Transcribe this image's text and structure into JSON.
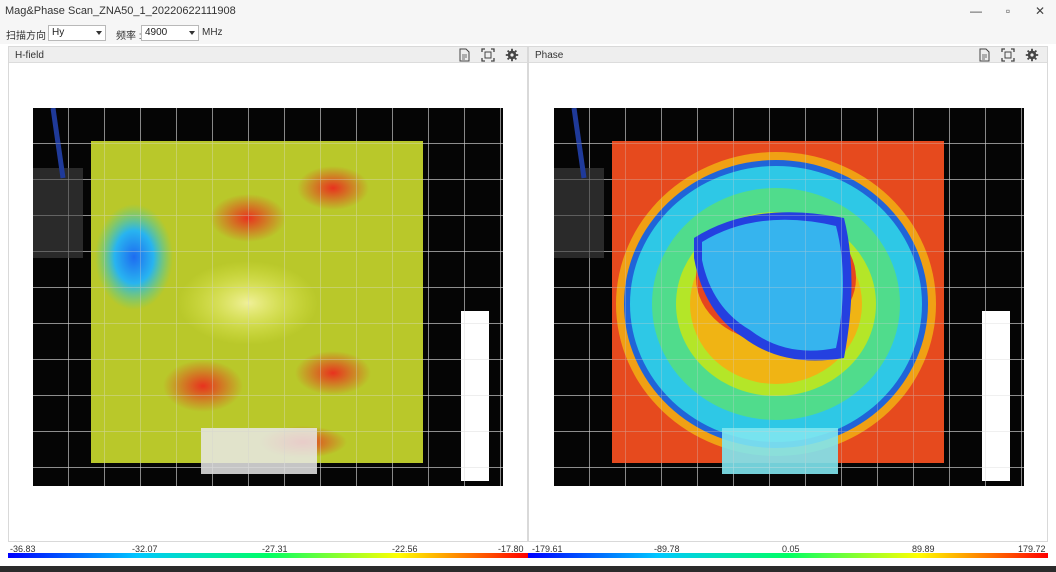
{
  "window": {
    "title": "Mag&Phase Scan_ZNA50_1_20220622111908",
    "controls": {
      "minimize": "—",
      "restore": "▫",
      "close": "✕"
    }
  },
  "toolbar": {
    "direction_label": "扫描方向 :",
    "direction_value": "Hy",
    "freq_label": "频率 :",
    "freq_value": "4900",
    "freq_unit": "MHz"
  },
  "panels": {
    "hfield": {
      "title": "H-field",
      "scale_labels": [
        "-36.83",
        "-32.07",
        "-27.31",
        "-22.56",
        "-17.80"
      ]
    },
    "phase": {
      "title": "Phase",
      "scale_labels": [
        "-179.61",
        "-89.78",
        "0.05",
        "89.89",
        "179.72"
      ]
    }
  },
  "icons": [
    "document-icon",
    "fit-screen-icon",
    "gear-icon"
  ],
  "colors": {
    "scale_gradient": [
      "#0000ff",
      "#00c8ff",
      "#00ff64",
      "#ffff00",
      "#ff0000"
    ],
    "window_bg": "#f6f6f6",
    "scan_bg": "#050505"
  }
}
